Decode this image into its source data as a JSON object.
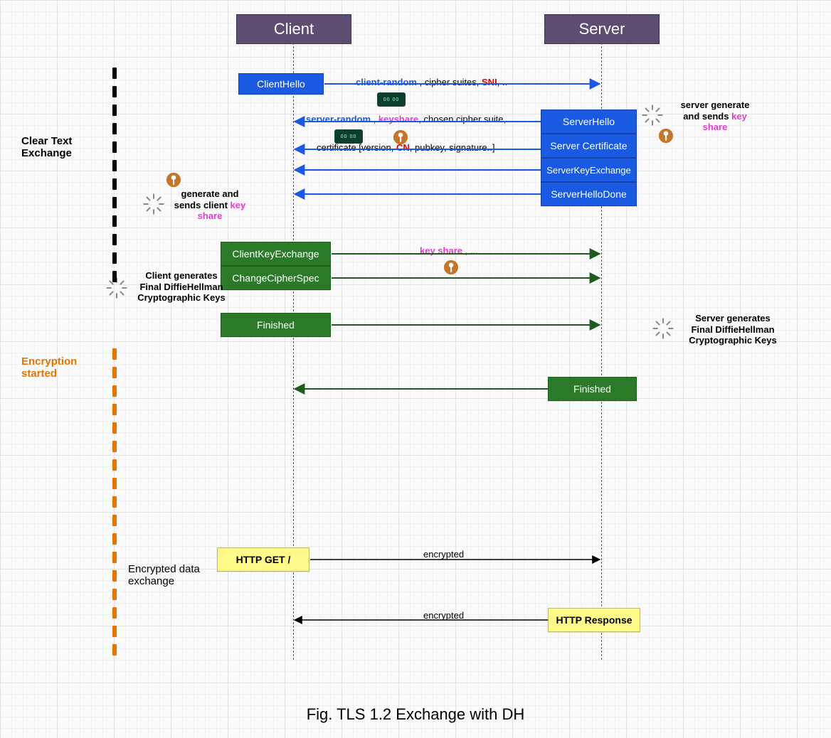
{
  "participants": {
    "client": "Client",
    "server": "Server"
  },
  "phase_labels": {
    "clear_text": "Clear Text\nExchange",
    "encryption_started": "Encryption\nstarted",
    "encrypted_data": "Encrypted data\nexchange"
  },
  "client": {
    "client_hello": "ClientHello",
    "client_key_exchange": "ClientKeyExchange",
    "change_cipher_spec": "ChangeCipherSpec",
    "finished": "Finished",
    "http_get": "HTTP GET /"
  },
  "server": {
    "server_hello": "ServerHello",
    "server_certificate": "Server Certificate",
    "server_key_exchange": "ServerKeyExchange",
    "server_hello_done": "ServerHelloDone",
    "finished": "Finished",
    "http_response": "HTTP Response"
  },
  "arrows": {
    "client_hello": {
      "parts": [
        {
          "text": "client-random",
          "cls": "blueTxt"
        },
        {
          "text": " , cipher suites, "
        },
        {
          "text": "SNI",
          "cls": "redTxt"
        },
        {
          "text": ", .."
        }
      ]
    },
    "server_hello": {
      "parts": [
        {
          "text": "server-random",
          "cls": "blueTxt"
        },
        {
          "text": " , "
        },
        {
          "text": "keyshare",
          "cls": "magTxt"
        },
        {
          "text": ", chosen cipher suite, .."
        }
      ]
    },
    "certificate": {
      "parts": [
        {
          "text": "certificate [version, "
        },
        {
          "text": "CN",
          "cls": "redTxt"
        },
        {
          "text": ", pubkey, signature..]"
        }
      ]
    },
    "client_key_exchange": {
      "parts": [
        {
          "text": "key share",
          "cls": "magTxt"
        },
        {
          "text": " , ..."
        }
      ]
    },
    "encrypted1": "encrypted",
    "encrypted2": "encrypted"
  },
  "notes": {
    "server_gen": {
      "pre": "server generate\nand sends ",
      "key": "key\nshare"
    },
    "client_gen": {
      "pre": "generate and\nsends client ",
      "key": "key\nshare"
    },
    "client_final": "Client generates\nFinal DiffieHellman\nCryptographic Keys",
    "server_final": "Server generates\nFinal DiffieHellman\nCryptographic Keys"
  },
  "caption": "Fig. TLS 1.2 Exchange with DH"
}
